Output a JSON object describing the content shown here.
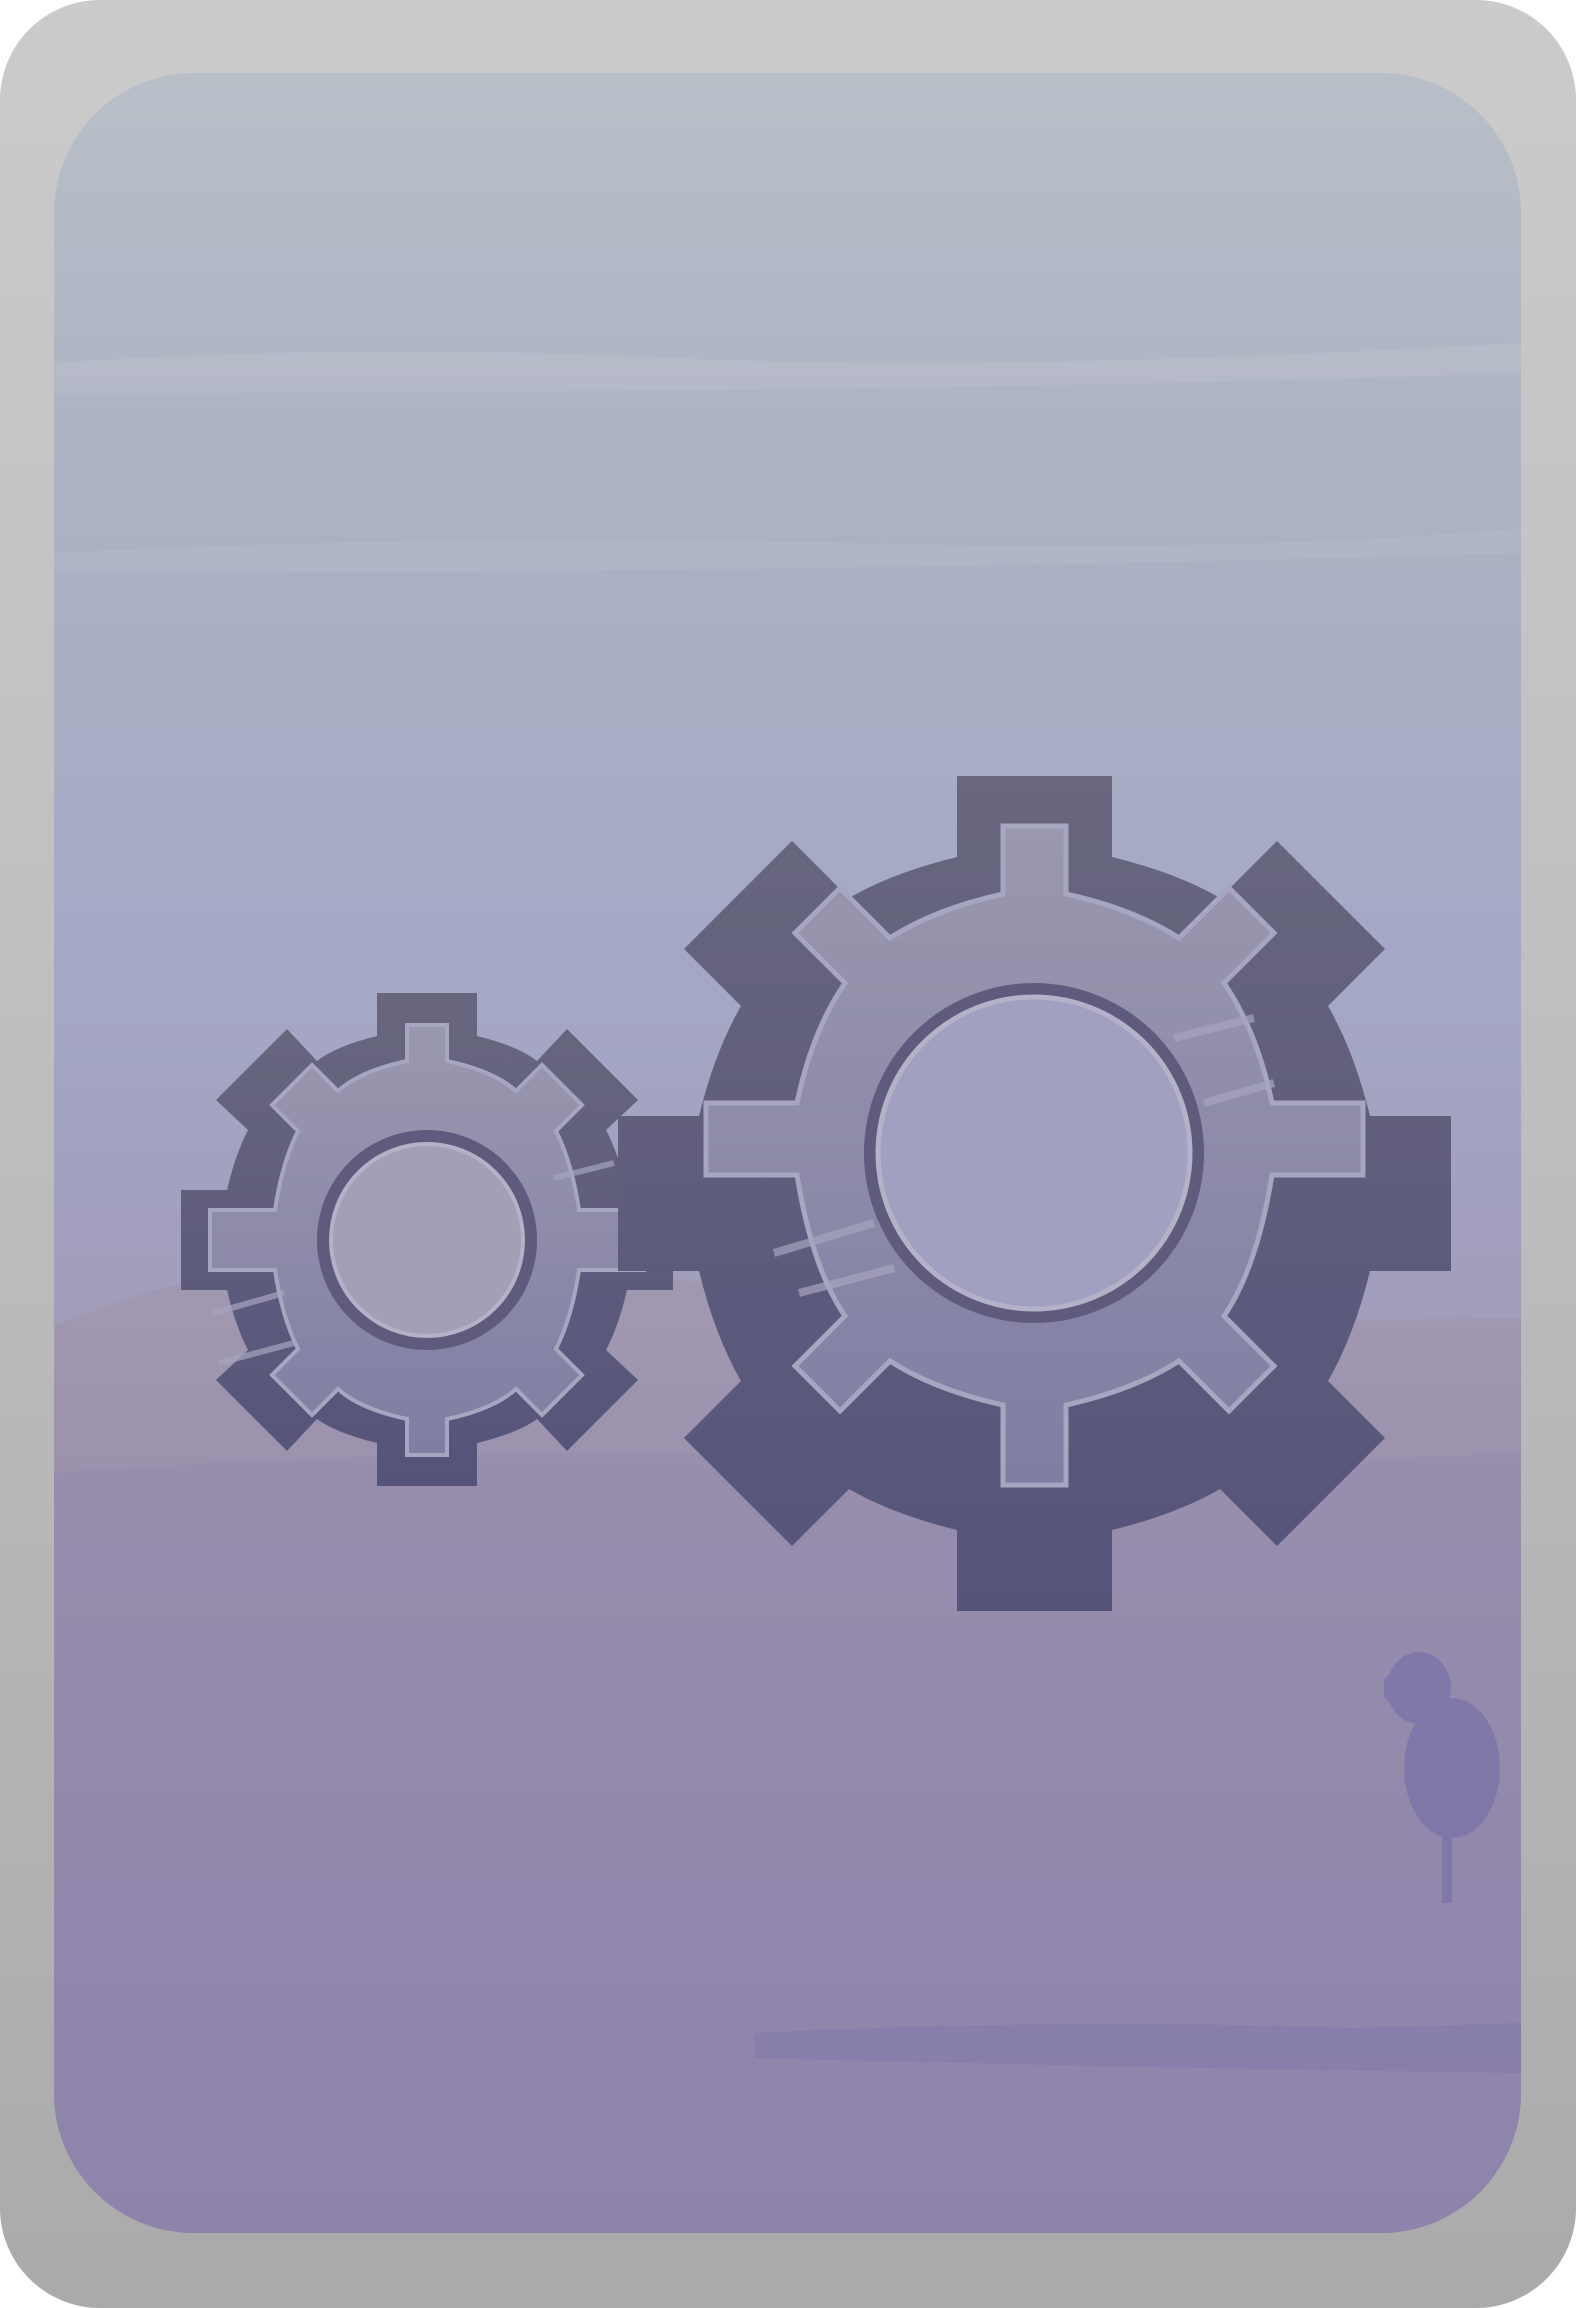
{
  "card": {
    "type": "card-back",
    "emblem": "gears-icon",
    "colors": {
      "frame": "#bdbdbd",
      "sky_top": "#b8bfc7",
      "sky_bottom": "#857aa8",
      "gear_outline": "#5e5b7c",
      "gear_face": "#8f8eaa"
    }
  }
}
